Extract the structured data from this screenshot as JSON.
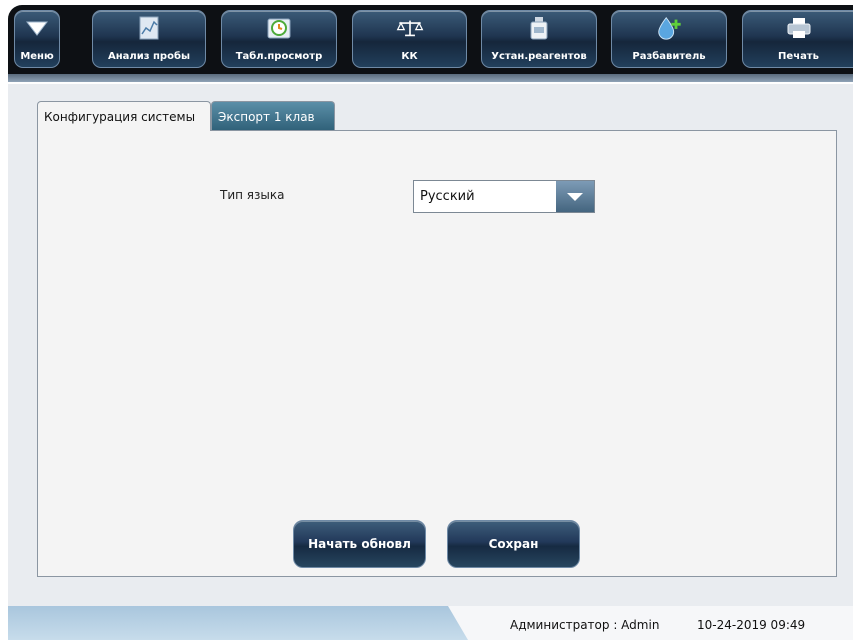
{
  "toolbar": {
    "menu": {
      "label": "Меню",
      "icon": "menu-triangle-icon"
    },
    "sample_analysis": {
      "label": "Анализ пробы",
      "icon": "sample-chart-icon"
    },
    "table_review": {
      "label": "Табл.просмотр",
      "icon": "clock-table-icon"
    },
    "qc": {
      "label": "КК",
      "icon": "scale-icon"
    },
    "reagent_setup": {
      "label": "Устан.реагентов",
      "icon": "reagent-bottle-icon"
    },
    "diluent": {
      "label": "Разбавитель",
      "icon": "droplet-plus-icon"
    },
    "print": {
      "label": "Печать",
      "icon": "printer-icon"
    }
  },
  "tabs": [
    {
      "label": "Конфигурация системы",
      "active": true
    },
    {
      "label": "Экспорт 1 клав",
      "active": false
    }
  ],
  "language": {
    "label": "Тип языка",
    "selected": "Русский"
  },
  "actions": {
    "start_update": "Начать обновл",
    "save": "Сохран"
  },
  "status": {
    "user": "Администратор : Admin",
    "datetime": "10-24-2019 09:49"
  },
  "colors": {
    "toolbar_bg": "#0d1014",
    "button_dark": "#1f3550",
    "inactive_tab": "#2f6078",
    "status_accent": "#a9c6dd"
  }
}
